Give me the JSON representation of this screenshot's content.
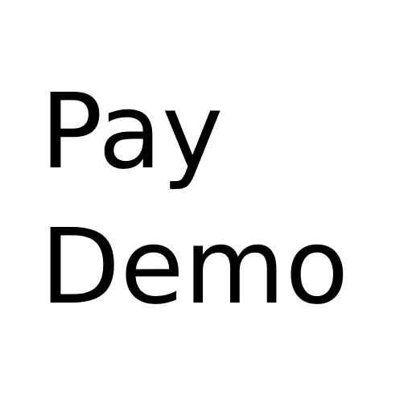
{
  "screen": {
    "title_line_1": "Pay",
    "title_line_2": "Demo",
    "background_color": "#ffffff",
    "text_color": "#000000"
  }
}
